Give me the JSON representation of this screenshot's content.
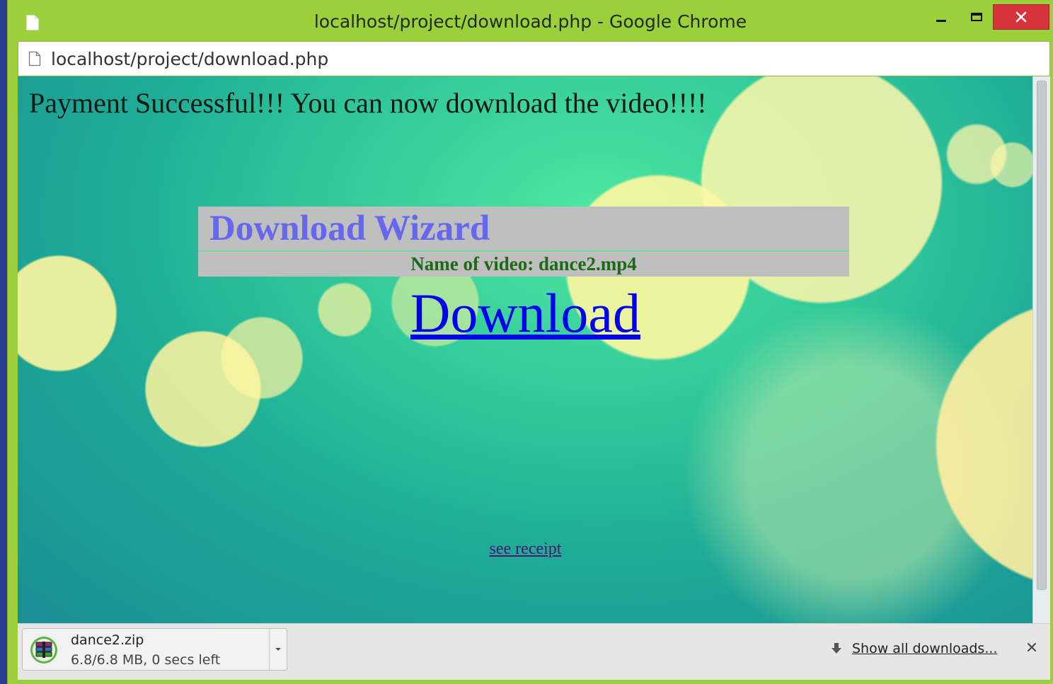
{
  "window": {
    "title": "localhost/project/download.php - Google Chrome"
  },
  "addressbar": {
    "url": "localhost/project/download.php"
  },
  "page": {
    "payment_message": "Payment Successful!!! You can now download the video!!!!",
    "wizard_title": "Download Wizard",
    "video_name": "Name of video: dance2.mp4",
    "download_link": "Download",
    "receipt_link": "see receipt"
  },
  "downloads": {
    "items": [
      {
        "filename": "dance2.zip",
        "status": "6.8/6.8 MB, 0 secs left",
        "progress": 1.0
      }
    ],
    "show_all": "Show all downloads..."
  },
  "icons": {
    "page": "page-icon",
    "minimize": "minimize-icon",
    "maximize": "maximize-icon",
    "close": "close-icon",
    "archive": "archive-icon",
    "dropdown": "chevron-down-icon",
    "download_arrow": "download-arrow-icon"
  },
  "colors": {
    "frame": "#9ccf3c",
    "close_button": "#d6333a",
    "wizard_panel": "#bfbfbf",
    "wizard_title": "#6666ee",
    "video_name": "#1a6a16",
    "link": "#0000ee",
    "visited_link": "#4a1570"
  }
}
